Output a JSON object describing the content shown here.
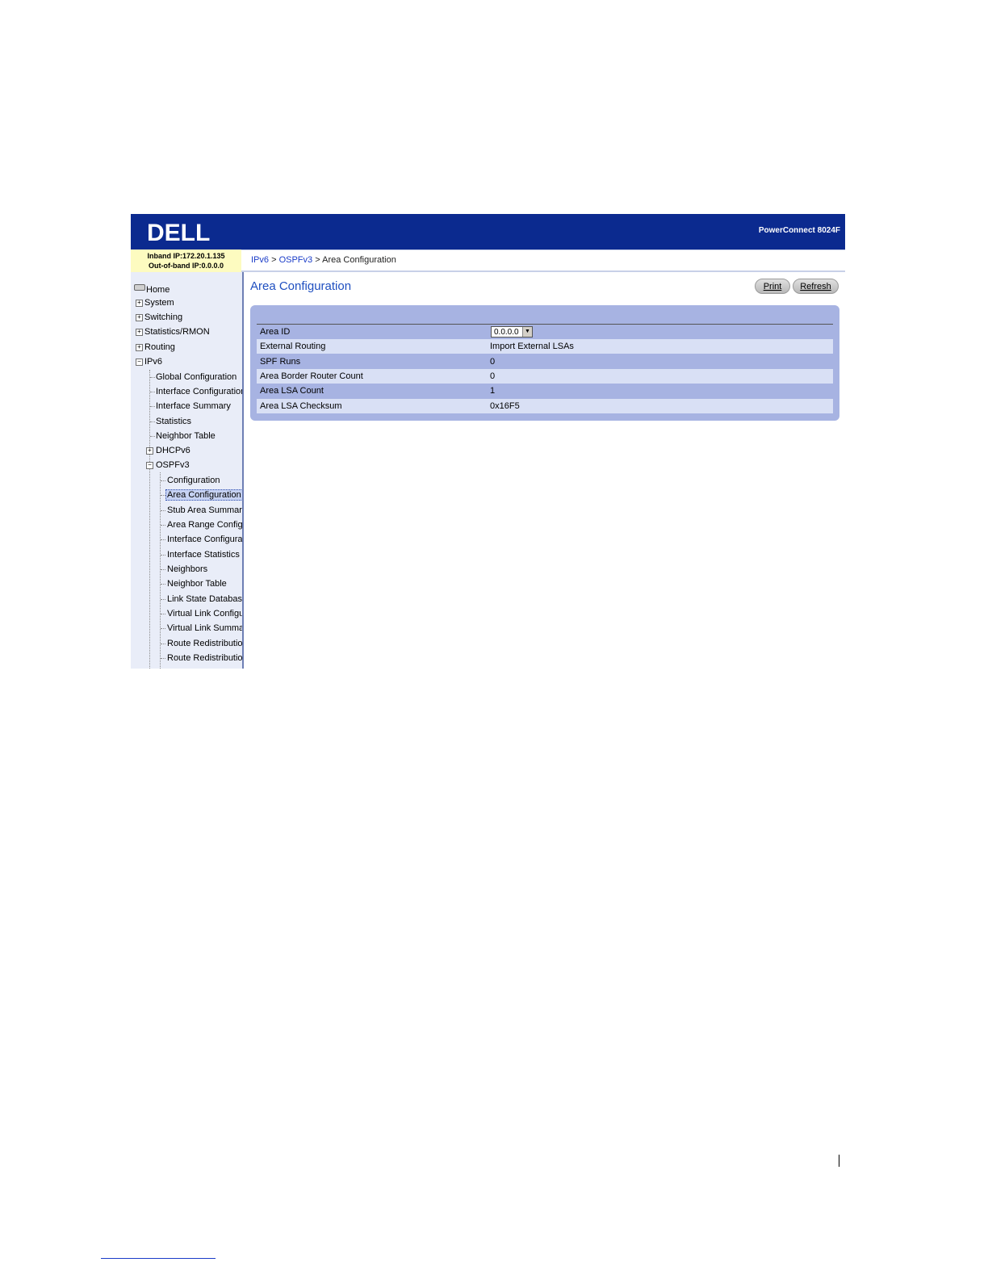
{
  "header": {
    "logo_text": "DELL",
    "product": "PowerConnect 8024F"
  },
  "ipinfo": {
    "inband": "Inband IP:172.20.1.135",
    "outofband": "Out-of-band IP:0.0.0.0"
  },
  "breadcrumb": {
    "item1": "IPv6",
    "sep1": ">",
    "item2": "OSPFv3",
    "sep2": ">",
    "current": "Area Configuration"
  },
  "sidebar": {
    "home": "Home",
    "system": "System",
    "switching": "Switching",
    "statistics_rmon": "Statistics/RMON",
    "routing": "Routing",
    "ipv6": "IPv6",
    "ipv6_children": [
      "Global Configuration",
      "Interface Configuration",
      "Interface Summary",
      "Statistics",
      "Neighbor Table"
    ],
    "dhcpv6": "DHCPv6",
    "ospfv3": "OSPFv3",
    "ospfv3_children": [
      "Configuration",
      "Area Configuration",
      "Stub Area Summary",
      "Area Range Configuration",
      "Interface Configuration",
      "Interface Statistics",
      "Neighbors",
      "Neighbor Table",
      "Link State Database",
      "Virtual Link Configuration",
      "Virtual Link Summary",
      "Route Redistribution",
      "Route Redistribution"
    ],
    "selected": "Area Configuration"
  },
  "main": {
    "title": "Area Configuration",
    "print_label": "Print",
    "refresh_label": "Refresh",
    "rows": [
      {
        "label": "Area ID",
        "value": "0.0.0.0"
      },
      {
        "label": "External Routing",
        "value": "Import External LSAs"
      },
      {
        "label": "SPF Runs",
        "value": "0"
      },
      {
        "label": "Area Border Router Count",
        "value": "0"
      },
      {
        "label": "Area LSA Count",
        "value": "1"
      },
      {
        "label": "Area LSA Checksum",
        "value": "0x16F5"
      }
    ]
  },
  "icons": {
    "expand": "+",
    "collapse": "−",
    "dropdown": "▼"
  },
  "colors": {
    "banner": "#0b2a8f",
    "panel": "#a7b3e2",
    "title": "#1f4fc0"
  }
}
